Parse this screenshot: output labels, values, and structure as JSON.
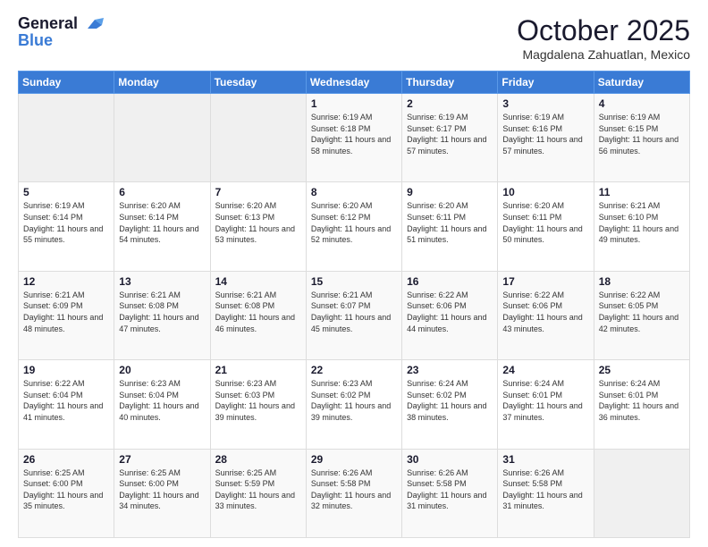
{
  "logo": {
    "line1": "General",
    "line2": "Blue"
  },
  "header": {
    "month": "October 2025",
    "location": "Magdalena Zahuatlan, Mexico"
  },
  "weekdays": [
    "Sunday",
    "Monday",
    "Tuesday",
    "Wednesday",
    "Thursday",
    "Friday",
    "Saturday"
  ],
  "weeks": [
    [
      {
        "day": "",
        "sunrise": "",
        "sunset": "",
        "daylight": ""
      },
      {
        "day": "",
        "sunrise": "",
        "sunset": "",
        "daylight": ""
      },
      {
        "day": "",
        "sunrise": "",
        "sunset": "",
        "daylight": ""
      },
      {
        "day": "1",
        "sunrise": "Sunrise: 6:19 AM",
        "sunset": "Sunset: 6:18 PM",
        "daylight": "Daylight: 11 hours and 58 minutes."
      },
      {
        "day": "2",
        "sunrise": "Sunrise: 6:19 AM",
        "sunset": "Sunset: 6:17 PM",
        "daylight": "Daylight: 11 hours and 57 minutes."
      },
      {
        "day": "3",
        "sunrise": "Sunrise: 6:19 AM",
        "sunset": "Sunset: 6:16 PM",
        "daylight": "Daylight: 11 hours and 57 minutes."
      },
      {
        "day": "4",
        "sunrise": "Sunrise: 6:19 AM",
        "sunset": "Sunset: 6:15 PM",
        "daylight": "Daylight: 11 hours and 56 minutes."
      }
    ],
    [
      {
        "day": "5",
        "sunrise": "Sunrise: 6:19 AM",
        "sunset": "Sunset: 6:14 PM",
        "daylight": "Daylight: 11 hours and 55 minutes."
      },
      {
        "day": "6",
        "sunrise": "Sunrise: 6:20 AM",
        "sunset": "Sunset: 6:14 PM",
        "daylight": "Daylight: 11 hours and 54 minutes."
      },
      {
        "day": "7",
        "sunrise": "Sunrise: 6:20 AM",
        "sunset": "Sunset: 6:13 PM",
        "daylight": "Daylight: 11 hours and 53 minutes."
      },
      {
        "day": "8",
        "sunrise": "Sunrise: 6:20 AM",
        "sunset": "Sunset: 6:12 PM",
        "daylight": "Daylight: 11 hours and 52 minutes."
      },
      {
        "day": "9",
        "sunrise": "Sunrise: 6:20 AM",
        "sunset": "Sunset: 6:11 PM",
        "daylight": "Daylight: 11 hours and 51 minutes."
      },
      {
        "day": "10",
        "sunrise": "Sunrise: 6:20 AM",
        "sunset": "Sunset: 6:11 PM",
        "daylight": "Daylight: 11 hours and 50 minutes."
      },
      {
        "day": "11",
        "sunrise": "Sunrise: 6:21 AM",
        "sunset": "Sunset: 6:10 PM",
        "daylight": "Daylight: 11 hours and 49 minutes."
      }
    ],
    [
      {
        "day": "12",
        "sunrise": "Sunrise: 6:21 AM",
        "sunset": "Sunset: 6:09 PM",
        "daylight": "Daylight: 11 hours and 48 minutes."
      },
      {
        "day": "13",
        "sunrise": "Sunrise: 6:21 AM",
        "sunset": "Sunset: 6:08 PM",
        "daylight": "Daylight: 11 hours and 47 minutes."
      },
      {
        "day": "14",
        "sunrise": "Sunrise: 6:21 AM",
        "sunset": "Sunset: 6:08 PM",
        "daylight": "Daylight: 11 hours and 46 minutes."
      },
      {
        "day": "15",
        "sunrise": "Sunrise: 6:21 AM",
        "sunset": "Sunset: 6:07 PM",
        "daylight": "Daylight: 11 hours and 45 minutes."
      },
      {
        "day": "16",
        "sunrise": "Sunrise: 6:22 AM",
        "sunset": "Sunset: 6:06 PM",
        "daylight": "Daylight: 11 hours and 44 minutes."
      },
      {
        "day": "17",
        "sunrise": "Sunrise: 6:22 AM",
        "sunset": "Sunset: 6:06 PM",
        "daylight": "Daylight: 11 hours and 43 minutes."
      },
      {
        "day": "18",
        "sunrise": "Sunrise: 6:22 AM",
        "sunset": "Sunset: 6:05 PM",
        "daylight": "Daylight: 11 hours and 42 minutes."
      }
    ],
    [
      {
        "day": "19",
        "sunrise": "Sunrise: 6:22 AM",
        "sunset": "Sunset: 6:04 PM",
        "daylight": "Daylight: 11 hours and 41 minutes."
      },
      {
        "day": "20",
        "sunrise": "Sunrise: 6:23 AM",
        "sunset": "Sunset: 6:04 PM",
        "daylight": "Daylight: 11 hours and 40 minutes."
      },
      {
        "day": "21",
        "sunrise": "Sunrise: 6:23 AM",
        "sunset": "Sunset: 6:03 PM",
        "daylight": "Daylight: 11 hours and 39 minutes."
      },
      {
        "day": "22",
        "sunrise": "Sunrise: 6:23 AM",
        "sunset": "Sunset: 6:02 PM",
        "daylight": "Daylight: 11 hours and 39 minutes."
      },
      {
        "day": "23",
        "sunrise": "Sunrise: 6:24 AM",
        "sunset": "Sunset: 6:02 PM",
        "daylight": "Daylight: 11 hours and 38 minutes."
      },
      {
        "day": "24",
        "sunrise": "Sunrise: 6:24 AM",
        "sunset": "Sunset: 6:01 PM",
        "daylight": "Daylight: 11 hours and 37 minutes."
      },
      {
        "day": "25",
        "sunrise": "Sunrise: 6:24 AM",
        "sunset": "Sunset: 6:01 PM",
        "daylight": "Daylight: 11 hours and 36 minutes."
      }
    ],
    [
      {
        "day": "26",
        "sunrise": "Sunrise: 6:25 AM",
        "sunset": "Sunset: 6:00 PM",
        "daylight": "Daylight: 11 hours and 35 minutes."
      },
      {
        "day": "27",
        "sunrise": "Sunrise: 6:25 AM",
        "sunset": "Sunset: 6:00 PM",
        "daylight": "Daylight: 11 hours and 34 minutes."
      },
      {
        "day": "28",
        "sunrise": "Sunrise: 6:25 AM",
        "sunset": "Sunset: 5:59 PM",
        "daylight": "Daylight: 11 hours and 33 minutes."
      },
      {
        "day": "29",
        "sunrise": "Sunrise: 6:26 AM",
        "sunset": "Sunset: 5:58 PM",
        "daylight": "Daylight: 11 hours and 32 minutes."
      },
      {
        "day": "30",
        "sunrise": "Sunrise: 6:26 AM",
        "sunset": "Sunset: 5:58 PM",
        "daylight": "Daylight: 11 hours and 31 minutes."
      },
      {
        "day": "31",
        "sunrise": "Sunrise: 6:26 AM",
        "sunset": "Sunset: 5:58 PM",
        "daylight": "Daylight: 11 hours and 31 minutes."
      },
      {
        "day": "",
        "sunrise": "",
        "sunset": "",
        "daylight": ""
      }
    ]
  ]
}
